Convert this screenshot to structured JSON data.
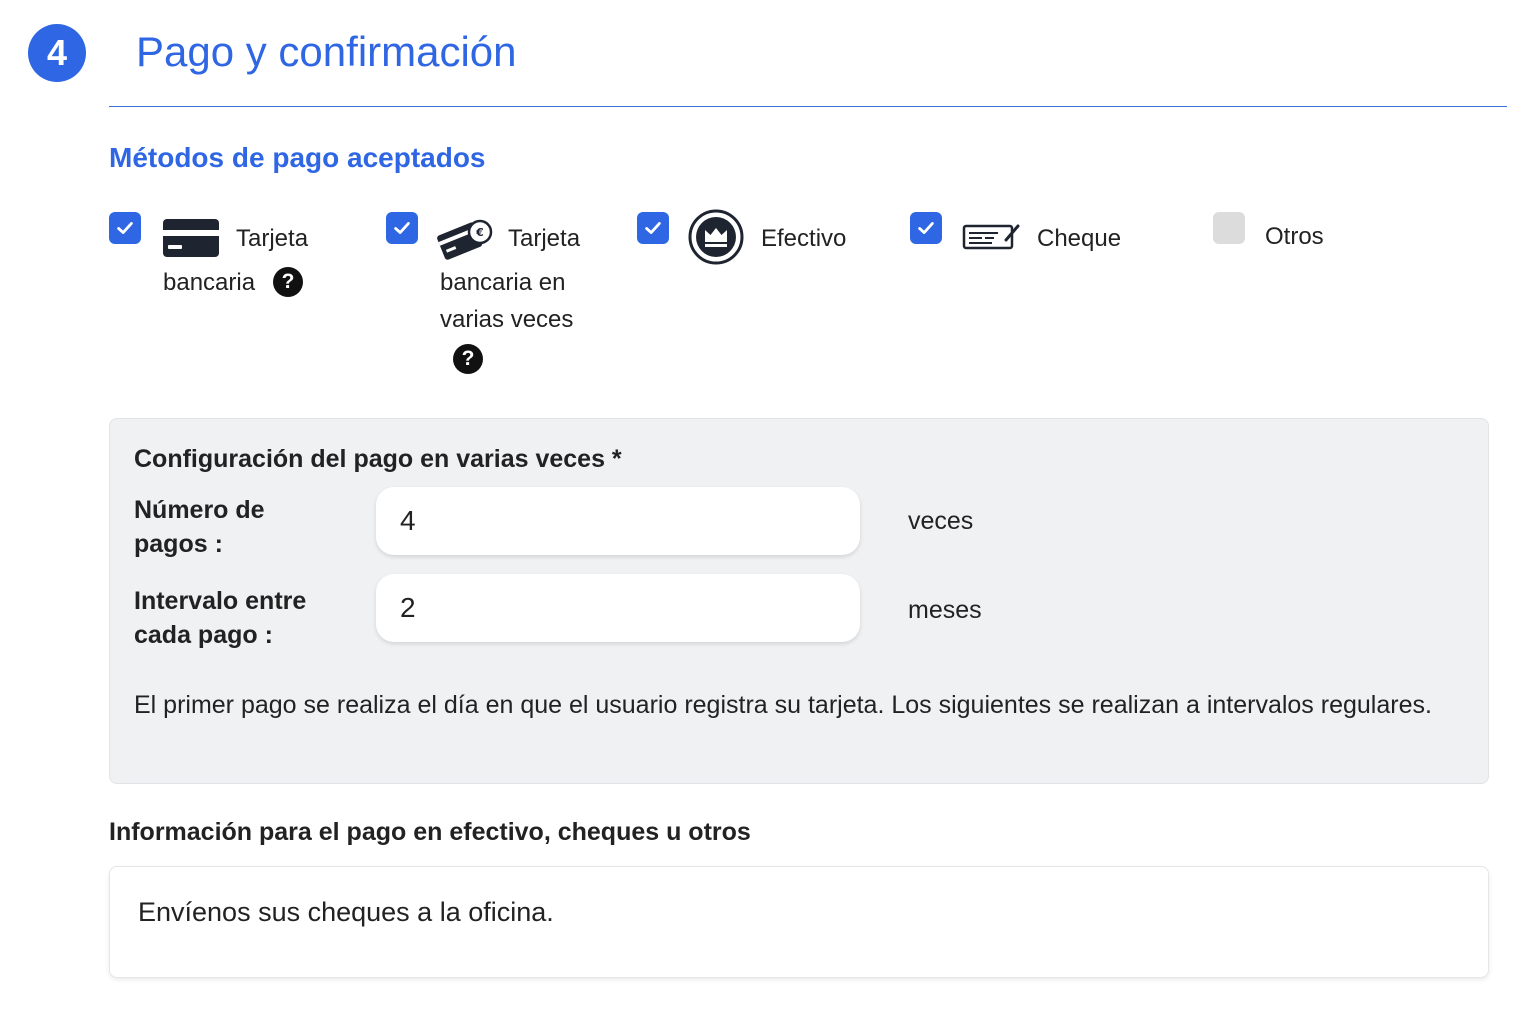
{
  "header": {
    "step_number": "4",
    "title": "Pago y confirmación"
  },
  "methods": {
    "title": "Métodos de pago aceptados",
    "items": [
      {
        "label_line1": "Tarjeta",
        "label_line2": "bancaria",
        "checked": true,
        "icon": "credit-card-icon",
        "has_help": true
      },
      {
        "label_line1": "Tarjeta",
        "label_line2": "bancaria en",
        "label_line3": "varias veces",
        "checked": true,
        "icon": "multi-payment-card-icon",
        "has_help": true
      },
      {
        "label_line1": "Efectivo",
        "checked": true,
        "icon": "cash-crown-icon",
        "has_help": false
      },
      {
        "label_line1": "Cheque",
        "checked": true,
        "icon": "cheque-icon",
        "has_help": false
      },
      {
        "label_line1": "Otros",
        "checked": false,
        "icon": "",
        "has_help": false
      }
    ]
  },
  "config": {
    "title": "Configuración del pago en varias veces *",
    "payments_label_line1": "Número de",
    "payments_label_line2": "pagos :",
    "payments_value": "4",
    "payments_unit": "veces",
    "interval_label_line1": "Intervalo entre",
    "interval_label_line2": "cada pago :",
    "interval_value": "2",
    "interval_unit": "meses",
    "note": "El primer pago se realiza el día en que el usuario registra su tarjeta. Los siguientes se realizan a intervalos regulares."
  },
  "info": {
    "title": "Información para el pago en efectivo, cheques u otros",
    "text": "Envíenos sus cheques a la oficina."
  },
  "colors": {
    "accent": "#2f66e3",
    "checkbox_off": "#dcdcdc",
    "panel_bg": "#f0f1f3"
  }
}
